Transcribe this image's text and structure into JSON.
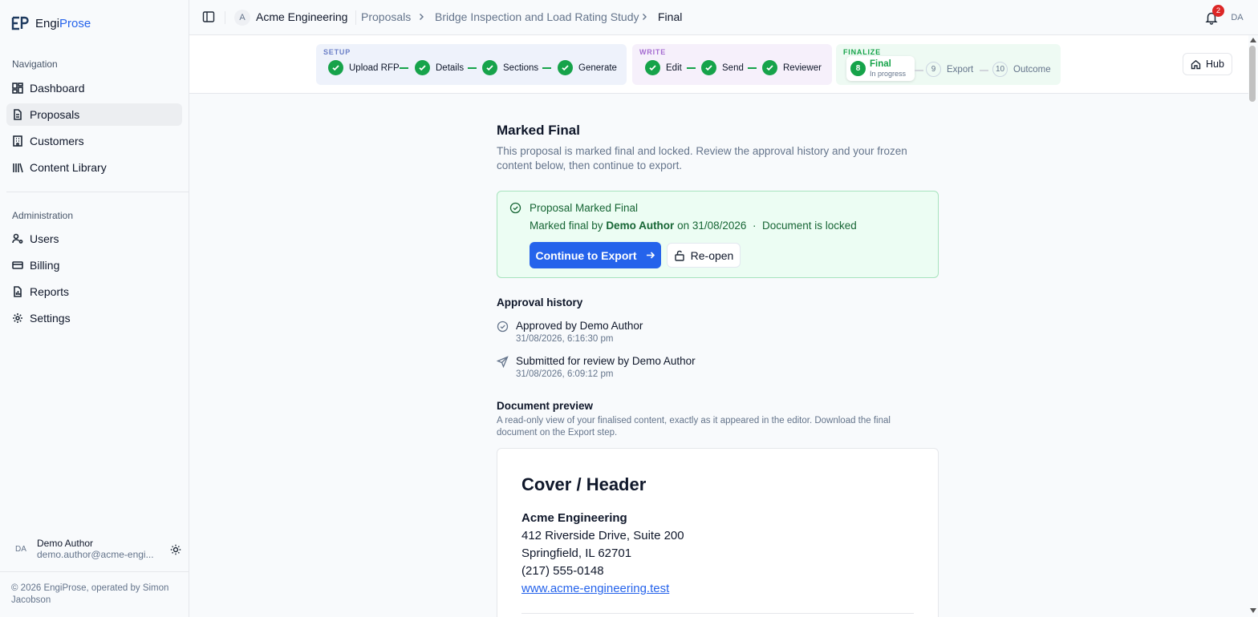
{
  "brand": {
    "name_part1": "Engi",
    "name_part2": "Prose"
  },
  "sidebar": {
    "nav_label": "Navigation",
    "nav_items": [
      {
        "label": "Dashboard",
        "icon": "dashboard-icon"
      },
      {
        "label": "Proposals",
        "icon": "document-icon",
        "active": true
      },
      {
        "label": "Customers",
        "icon": "building-icon"
      },
      {
        "label": "Content Library",
        "icon": "library-icon"
      }
    ],
    "admin_label": "Administration",
    "admin_items": [
      {
        "label": "Users",
        "icon": "user-cog-icon"
      },
      {
        "label": "Billing",
        "icon": "credit-card-icon"
      },
      {
        "label": "Reports",
        "icon": "report-icon"
      },
      {
        "label": "Settings",
        "icon": "gear-icon"
      }
    ],
    "user": {
      "initials": "DA",
      "name": "Demo Author",
      "email": "demo.author@acme-engi..."
    },
    "copyright": "© 2026 EngiProse, operated by Simon Jacobson"
  },
  "topbar": {
    "org_initial": "A",
    "org_name": "Acme Engineering",
    "breadcrumbs": [
      "Proposals",
      "Bridge Inspection and Load Rating Study",
      "Final"
    ],
    "notification_count": "2",
    "user_initials": "DA"
  },
  "stepper": {
    "groups": [
      {
        "label": "SETUP",
        "steps": [
          "Upload RFP",
          "Details",
          "Sections",
          "Generate"
        ]
      },
      {
        "label": "WRITE",
        "steps": [
          "Edit",
          "Send",
          "Reviewer"
        ]
      },
      {
        "label": "FINALIZE",
        "current": {
          "number": "8",
          "label": "Final",
          "status": "In progress"
        },
        "upcoming": [
          {
            "number": "9",
            "label": "Export"
          },
          {
            "number": "10",
            "label": "Outcome"
          }
        ]
      }
    ],
    "hub_label": "Hub",
    "colors": {
      "setup_bg": "#eef2fb",
      "setup_label": "#6b7fc7",
      "write_bg": "#f6f0fb",
      "write_label": "#a56cd1",
      "finalize_bg": "#eefaf3",
      "finalize_label": "#16a34a",
      "done": "#16a34a"
    }
  },
  "main": {
    "title": "Marked Final",
    "description": "This proposal is marked final and locked. Review the approval history and your frozen content below, then continue to export.",
    "final_box": {
      "title": "Proposal Marked Final",
      "meta_prefix": "Marked final by",
      "meta_author": "Demo Author",
      "meta_on": "on 31/08/2026",
      "meta_sep": "·",
      "meta_locked": "Document is locked",
      "continue_label": "Continue to Export",
      "reopen_label": "Re-open"
    },
    "history_title": "Approval history",
    "history": [
      {
        "action": "Approved",
        "by": "by Demo Author",
        "date": "31/08/2026, 6:16:30 pm",
        "icon": "check-circle-icon"
      },
      {
        "action": "Submitted for review",
        "by": "by Demo Author",
        "date": "31/08/2026, 6:09:12 pm",
        "icon": "send-icon"
      }
    ],
    "preview_title": "Document preview",
    "preview_note": "A read-only view of your finalised content, exactly as it appeared in the editor. Download the final document on the Export step.",
    "doc": {
      "heading": "Cover / Header",
      "company": "Acme Engineering",
      "address1": "412 Riverside Drive, Suite 200",
      "address2": "Springfield, IL 62701",
      "phone": "(217) 555-0148",
      "website": "www.acme-engineering.test"
    }
  }
}
